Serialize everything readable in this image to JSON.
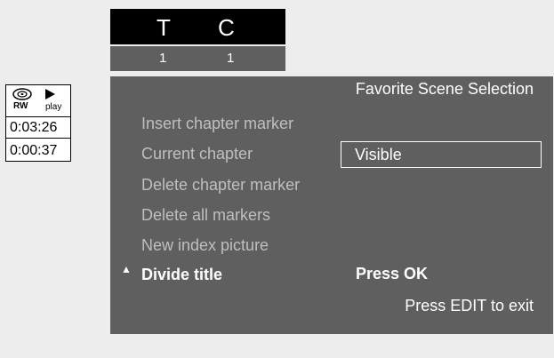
{
  "title_chapter": {
    "title_letter": "T",
    "chapter_letter": "C",
    "title_number": "1",
    "chapter_number": "1"
  },
  "status": {
    "disc_label": "RW",
    "mode_label": "play",
    "elapsed": "0:03:26",
    "chapter_time": "0:00:37"
  },
  "menu": {
    "title": "Favorite Scene Selection",
    "items": [
      {
        "label": "Insert chapter marker"
      },
      {
        "label": "Current chapter"
      },
      {
        "label": "Delete chapter marker"
      },
      {
        "label": "Delete all markers"
      },
      {
        "label": "New index picture"
      },
      {
        "label": "Divide title"
      }
    ],
    "current_chapter_value": "Visible",
    "action_hint": "Press OK",
    "exit_hint": "Press EDIT to exit"
  }
}
